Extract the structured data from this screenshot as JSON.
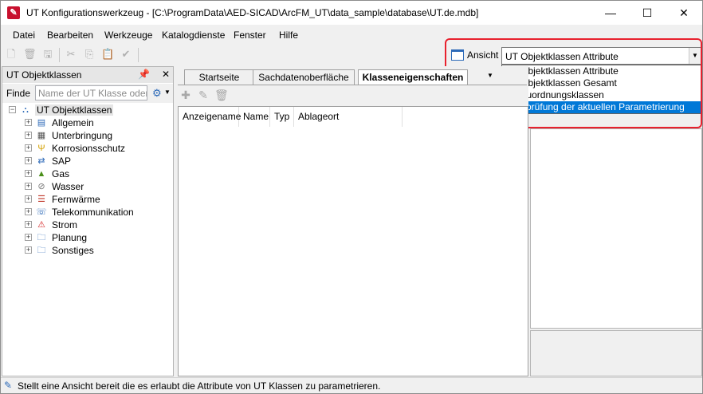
{
  "window": {
    "title": "UT Konfigurationswerkzeug - [C:\\ProgramData\\AED-SICAD\\ArcFM_UT\\data_sample\\database\\UT.de.mdb]",
    "minimize": "—",
    "maximize": "☐",
    "close": "✕"
  },
  "menu": [
    "Datei",
    "Bearbeiten",
    "Werkzeuge",
    "Katalogdienste",
    "Fenster",
    "Hilfe"
  ],
  "ansicht": {
    "label": "Ansicht",
    "selected": "UT Objektklassen Attribute",
    "options": [
      "UT Objektklassen Attribute",
      "UT Objektklassen Gesamt",
      "UT Zuordnungsklassen",
      "Überprüfung der aktuellen Parametrierung"
    ],
    "highlighted_index": 3
  },
  "left_panel": {
    "title": "UT Objektklassen",
    "pin": "📌",
    "close": "✕",
    "find_label": "Finde",
    "find_placeholder": "Name der UT Klasse oder Schicht",
    "tree": {
      "root": "UT Objektklassen",
      "items": [
        {
          "label": "Allgemein",
          "icon": "general-icon"
        },
        {
          "label": "Unterbringung",
          "icon": "housing-icon"
        },
        {
          "label": "Korrosionsschutz",
          "icon": "corrosion-icon"
        },
        {
          "label": "SAP",
          "icon": "sap-icon"
        },
        {
          "label": "Gas",
          "icon": "gas-icon"
        },
        {
          "label": "Wasser",
          "icon": "water-icon"
        },
        {
          "label": "Fernwärme",
          "icon": "district-heating-icon"
        },
        {
          "label": "Telekommunikation",
          "icon": "telecom-icon"
        },
        {
          "label": "Strom",
          "icon": "power-icon"
        },
        {
          "label": "Planung",
          "icon": "folder-icon"
        },
        {
          "label": "Sonstiges",
          "icon": "folder-icon"
        }
      ]
    }
  },
  "center": {
    "tabs": [
      "Startseite",
      "Sachdatenoberfläche",
      "Klasseneigenschaften"
    ],
    "active_tab": 2,
    "columns": [
      "Anzeigename",
      "Name",
      "Typ",
      "Ablageort"
    ]
  },
  "status": {
    "text": "Stellt eine Ansicht bereit die es erlaubt die Attribute von UT Klassen zu parametrieren."
  },
  "colors": {
    "accent": "#0078d7",
    "highlight_border": "#e8212e"
  }
}
